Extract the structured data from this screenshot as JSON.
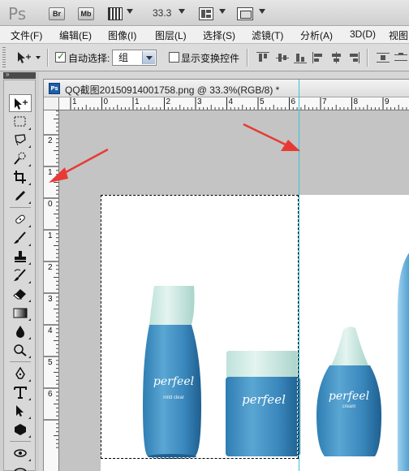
{
  "app": {
    "logo": "Ps",
    "buttons": {
      "bridge": "Br",
      "mini_bridge": "Mb"
    },
    "zoom": "33.3"
  },
  "menu": [
    "文件(F)",
    "编辑(E)",
    "图像(I)",
    "图层(L)",
    "选择(S)",
    "滤镜(T)",
    "分析(A)",
    "3D(D)",
    "视图"
  ],
  "options": {
    "auto_select_label": "自动选择:",
    "auto_select_checked": true,
    "auto_select_value": "组",
    "show_transform_label": "显示变换控件",
    "show_transform_checked": false
  },
  "document": {
    "title": "QQ截图20150914001758.png @ 33.3%(RGB/8) *",
    "ruler_h": [
      "1",
      "0",
      "1",
      "2",
      "3",
      "4",
      "5",
      "6",
      "7",
      "8",
      "9"
    ],
    "ruler_v": [
      "2",
      "1",
      "0",
      "1",
      "2",
      "3",
      "4",
      "5",
      "6"
    ]
  },
  "products": [
    {
      "brand": "perfeel",
      "sub": "mild clear"
    },
    {
      "brand": "perfeel",
      "sub": ""
    },
    {
      "brand": "perfeel",
      "sub": "cream"
    }
  ],
  "colors": {
    "guide": "#36c3d8",
    "arrow": "#e83a35",
    "bottle": "#3e8ec0"
  }
}
